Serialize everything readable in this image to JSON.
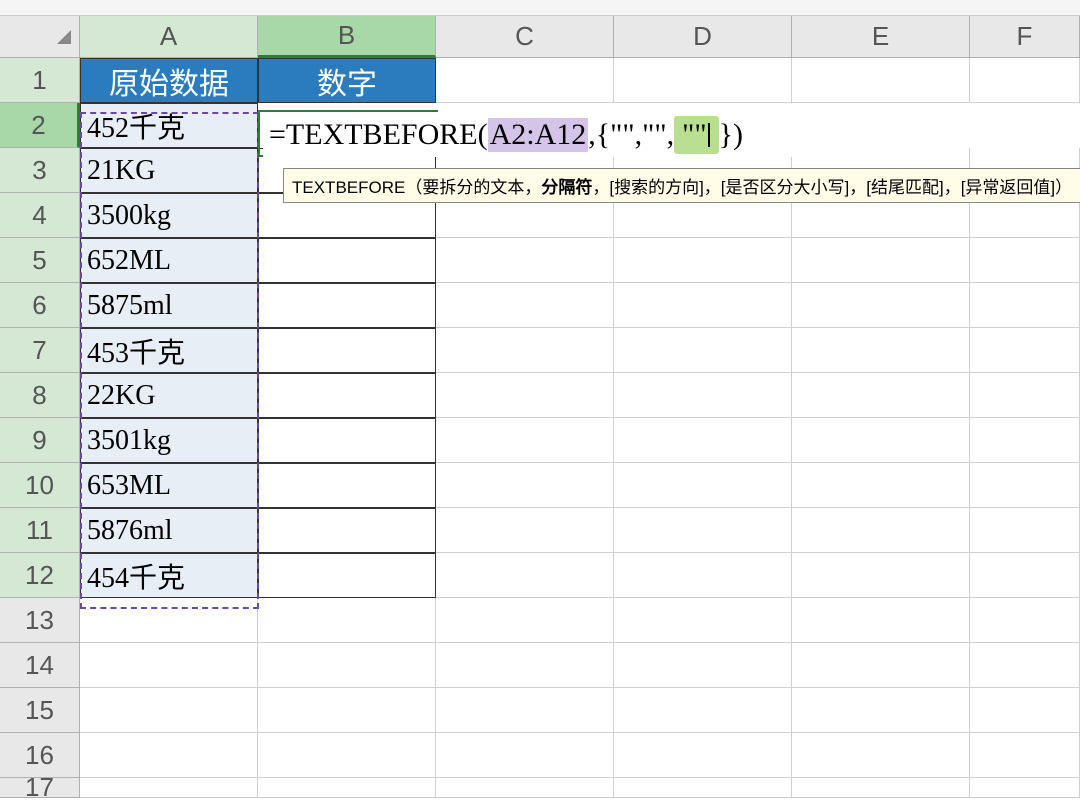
{
  "columns": [
    "A",
    "B",
    "C",
    "D",
    "E",
    "F"
  ],
  "rows": [
    1,
    2,
    3,
    4,
    5,
    6,
    7,
    8,
    9,
    10,
    11,
    12,
    13,
    14,
    15,
    16,
    17
  ],
  "headers": {
    "col_a": "原始数据",
    "col_b": "数字"
  },
  "data": {
    "a2": "452千克",
    "a3": "21KG",
    "a4": "3500kg",
    "a5": "652ML",
    "a6": "5875ml",
    "a7": "453千克",
    "a8": "22KG",
    "a9": "3501kg",
    "a10": "653ML",
    "a11": "5876ml",
    "a12": "454千克"
  },
  "formula": {
    "prefix": "=TEXTBEFORE(",
    "ref": "A2:A12",
    "middle": ",{\"\",\"\",",
    "cursor_quote": "\"\"",
    "suffix": "})"
  },
  "tooltip": {
    "func": "TEXTBEFORE",
    "open": "（要拆分的文本，",
    "bold": "分隔符",
    "rest": "，[搜索的方向]，[是否区分大小写]，[结尾匹配]，[异常返回值]）"
  }
}
